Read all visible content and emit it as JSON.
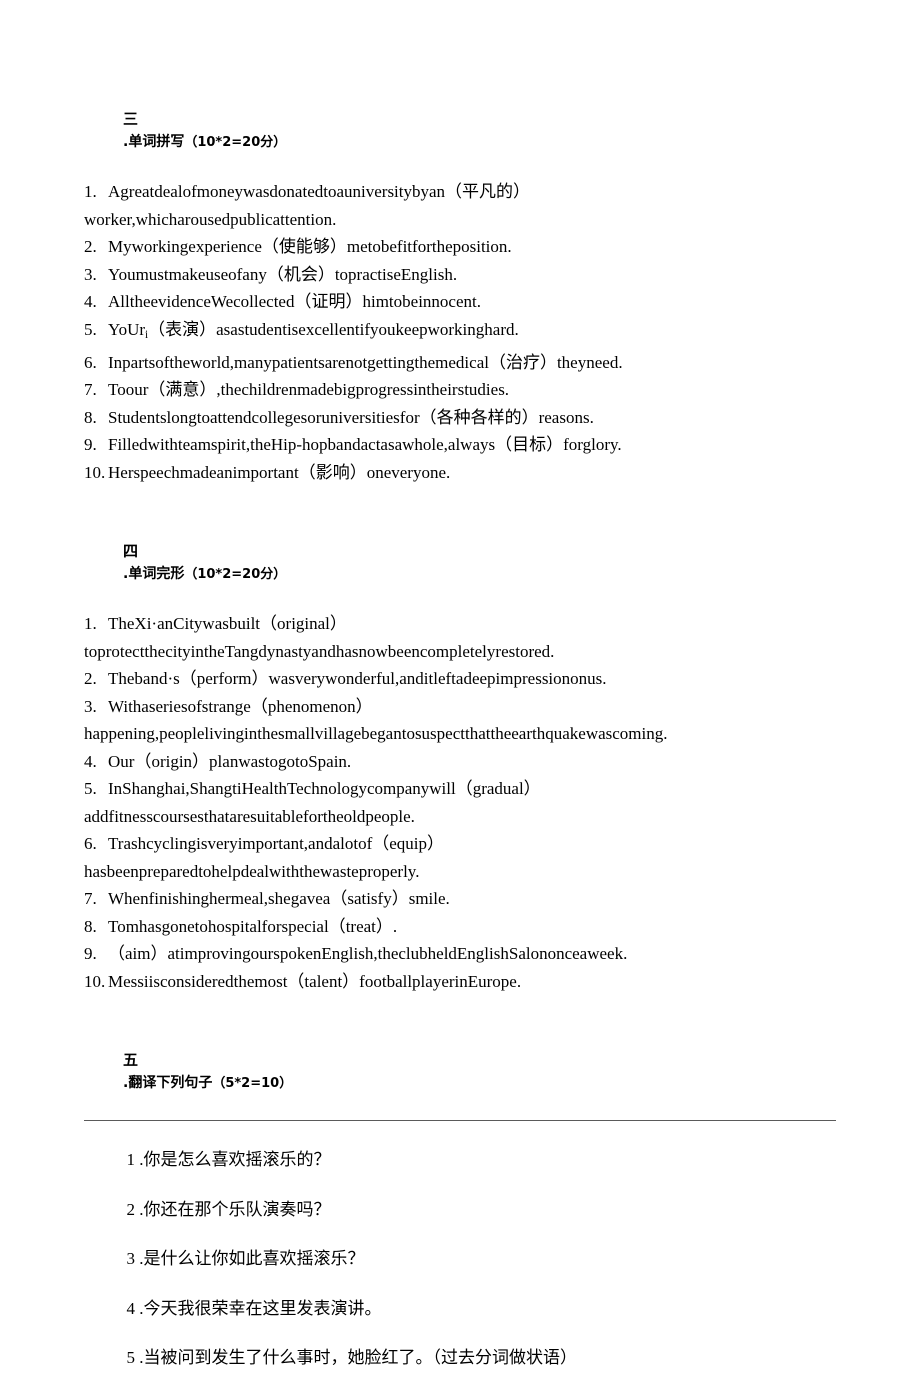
{
  "document": {
    "sections": [
      {
        "id": "section-3",
        "heading": "三　.单词拼写（10*2=20分）",
        "heading_cn_numeral": "三",
        "heading_title": ".单词拼写",
        "heading_score": "（10*2=20分）",
        "items": [
          {
            "num": "1.",
            "text": "Agreatdealofmoneywasdonatedtoauniversitybyan（平凡的）",
            "cont": "worker,whicharousedpublicattention."
          },
          {
            "num": "2.",
            "text": "Myworkingexperience（使能够）metobefitfortheposition."
          },
          {
            "num": "3.",
            "text": "Youmustmakeuseofany（机会）topractiseEnglish."
          },
          {
            "num": "4.",
            "text": "AlltheevidenceWecollected（证明）himtobeinnocent."
          },
          {
            "num": "5.",
            "text_pre": "YoUr",
            "text_sub": "i",
            "text_post": "（表演）asastudentisexcellentifyoukeepworkinghard."
          },
          {
            "num": "6.",
            "text": "Inpartsoftheworld,manypatientsarenotgettingthemedical（治疗）theyneed."
          },
          {
            "num": "7.",
            "text": "Toour（满意）,thechildrenmadebigprogressintheirstudies."
          },
          {
            "num": "8.",
            "text": "Studentslongtoattendcollegesoruniversitiesfor（各种各样的）reasons."
          },
          {
            "num": "9.",
            "text": "Filledwithteamspirit,theHip-hopbandactasawhole,always（目标）forglory."
          },
          {
            "num": "10.",
            "text": "Herspeechmadeanimportant（影响）oneveryone."
          }
        ]
      },
      {
        "id": "section-4",
        "heading": "四　.单词完形（10*2=20分）",
        "heading_cn_numeral": "四",
        "heading_title": ".单词完形",
        "heading_score": "（10*2=20分）",
        "items": [
          {
            "num": "1.",
            "text": "TheXi·anCitywasbuilt（original）",
            "cont": "toprotectthecityintheTangdynastyandhasnowbeencompletelyrestored."
          },
          {
            "num": "2.",
            "text": "Theband·s（perform）wasverywonderful,anditleftadeepimpressiononus."
          },
          {
            "num": "3.",
            "text": "Withaseriesofstrange（phenomenon）",
            "cont": "happening,peoplelivinginthesmallvillagebegantosuspectthattheearthquakewascoming."
          },
          {
            "num": "4.",
            "text": "Our（origin）planwastogotoSpain."
          },
          {
            "num": "5.",
            "text": "InShanghai,ShangtiHealthTechnologycompanywill（gradual）",
            "cont": "addfitnesscoursesthataresuitablefortheoldpeople."
          },
          {
            "num": "6.",
            "text": "Trashcyclingisveryimportant,andalotof（equip）",
            "cont": "hasbeenpreparedtohelpdealwiththewasteproperly."
          },
          {
            "num": "7.",
            "text": "Whenfinishinghermeal,shegavea（satisfy）smile."
          },
          {
            "num": "8.",
            "text": "Tomhasgonetohospitalforspecial（treat）."
          },
          {
            "num": "9.",
            "text": "（aim）atimprovingourspokenEnglish,theclubheldEnglishSalononceaweek."
          },
          {
            "num": "10.",
            "text": "Messiisconsideredthemost（talent）footballplayerinEurope."
          }
        ]
      },
      {
        "id": "section-5",
        "heading": "五　.翻译下列句子（5*2=10）",
        "heading_cn_numeral": "五",
        "heading_title": ".翻译下列句子",
        "heading_score": "（5*2=10）",
        "items": [
          {
            "num": "1 .",
            "text": "你是怎么喜欢摇滚乐的？"
          },
          {
            "num": "2 .",
            "text": "你还在那个乐队演奏吗？"
          },
          {
            "num": "3 .",
            "text": "是什么让你如此喜欢摇滚乐？"
          },
          {
            "num": "4 .",
            "text": "今天我很荣幸在这里发表演讲。"
          },
          {
            "num": "5 .",
            "text": "当被问到发生了什么事时，她脸红了。（过去分词做状语）"
          }
        ]
      }
    ]
  },
  "colors": {
    "text": "#000000",
    "rule": "#5a5a5a",
    "background": "#ffffff"
  }
}
